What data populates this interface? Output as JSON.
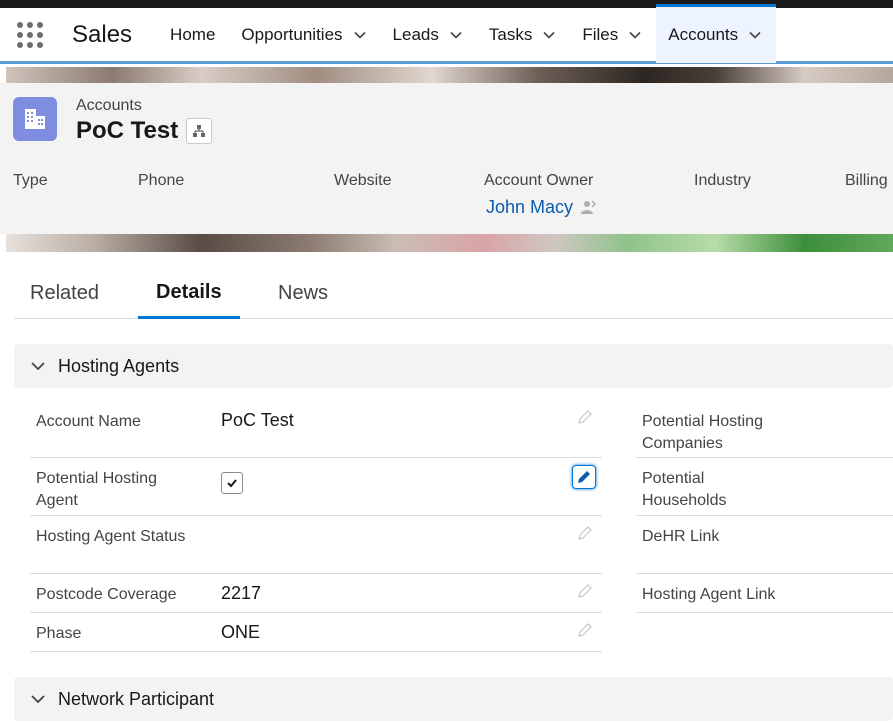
{
  "nav": {
    "app_name": "Sales",
    "items": [
      {
        "label": "Home"
      },
      {
        "label": "Opportunities"
      },
      {
        "label": "Leads"
      },
      {
        "label": "Tasks"
      },
      {
        "label": "Files"
      },
      {
        "label": "Accounts"
      }
    ]
  },
  "header": {
    "object_label": "Accounts",
    "record_title": "PoC Test"
  },
  "highlights": {
    "type_label": "Type",
    "phone_label": "Phone",
    "website_label": "Website",
    "owner_label": "Account Owner",
    "owner_value": "John Macy",
    "industry_label": "Industry",
    "billing_label": "Billing"
  },
  "tabs": [
    {
      "label": "Related"
    },
    {
      "label": "Details"
    },
    {
      "label": "News"
    }
  ],
  "sections": {
    "hosting_agents": "Hosting Agents",
    "network_participant": "Network Participant"
  },
  "fields_left": [
    {
      "label": "Account Name",
      "value": "PoC Test"
    },
    {
      "label": "Potential Hosting Agent",
      "value": ""
    },
    {
      "label": "Hosting Agent Status",
      "value": ""
    },
    {
      "label": "Postcode Coverage",
      "value": "2217"
    },
    {
      "label": "Phase",
      "value": "ONE"
    }
  ],
  "fields_right": [
    {
      "label": "Potential Hosting Companies"
    },
    {
      "label": "Potential Households"
    },
    {
      "label": "DeHR Link"
    },
    {
      "label": "Hosting Agent Link"
    }
  ],
  "colors": {
    "brand_blue": "#0176d3",
    "link_blue": "#0b5cab",
    "object_icon": "#7f8de1"
  }
}
